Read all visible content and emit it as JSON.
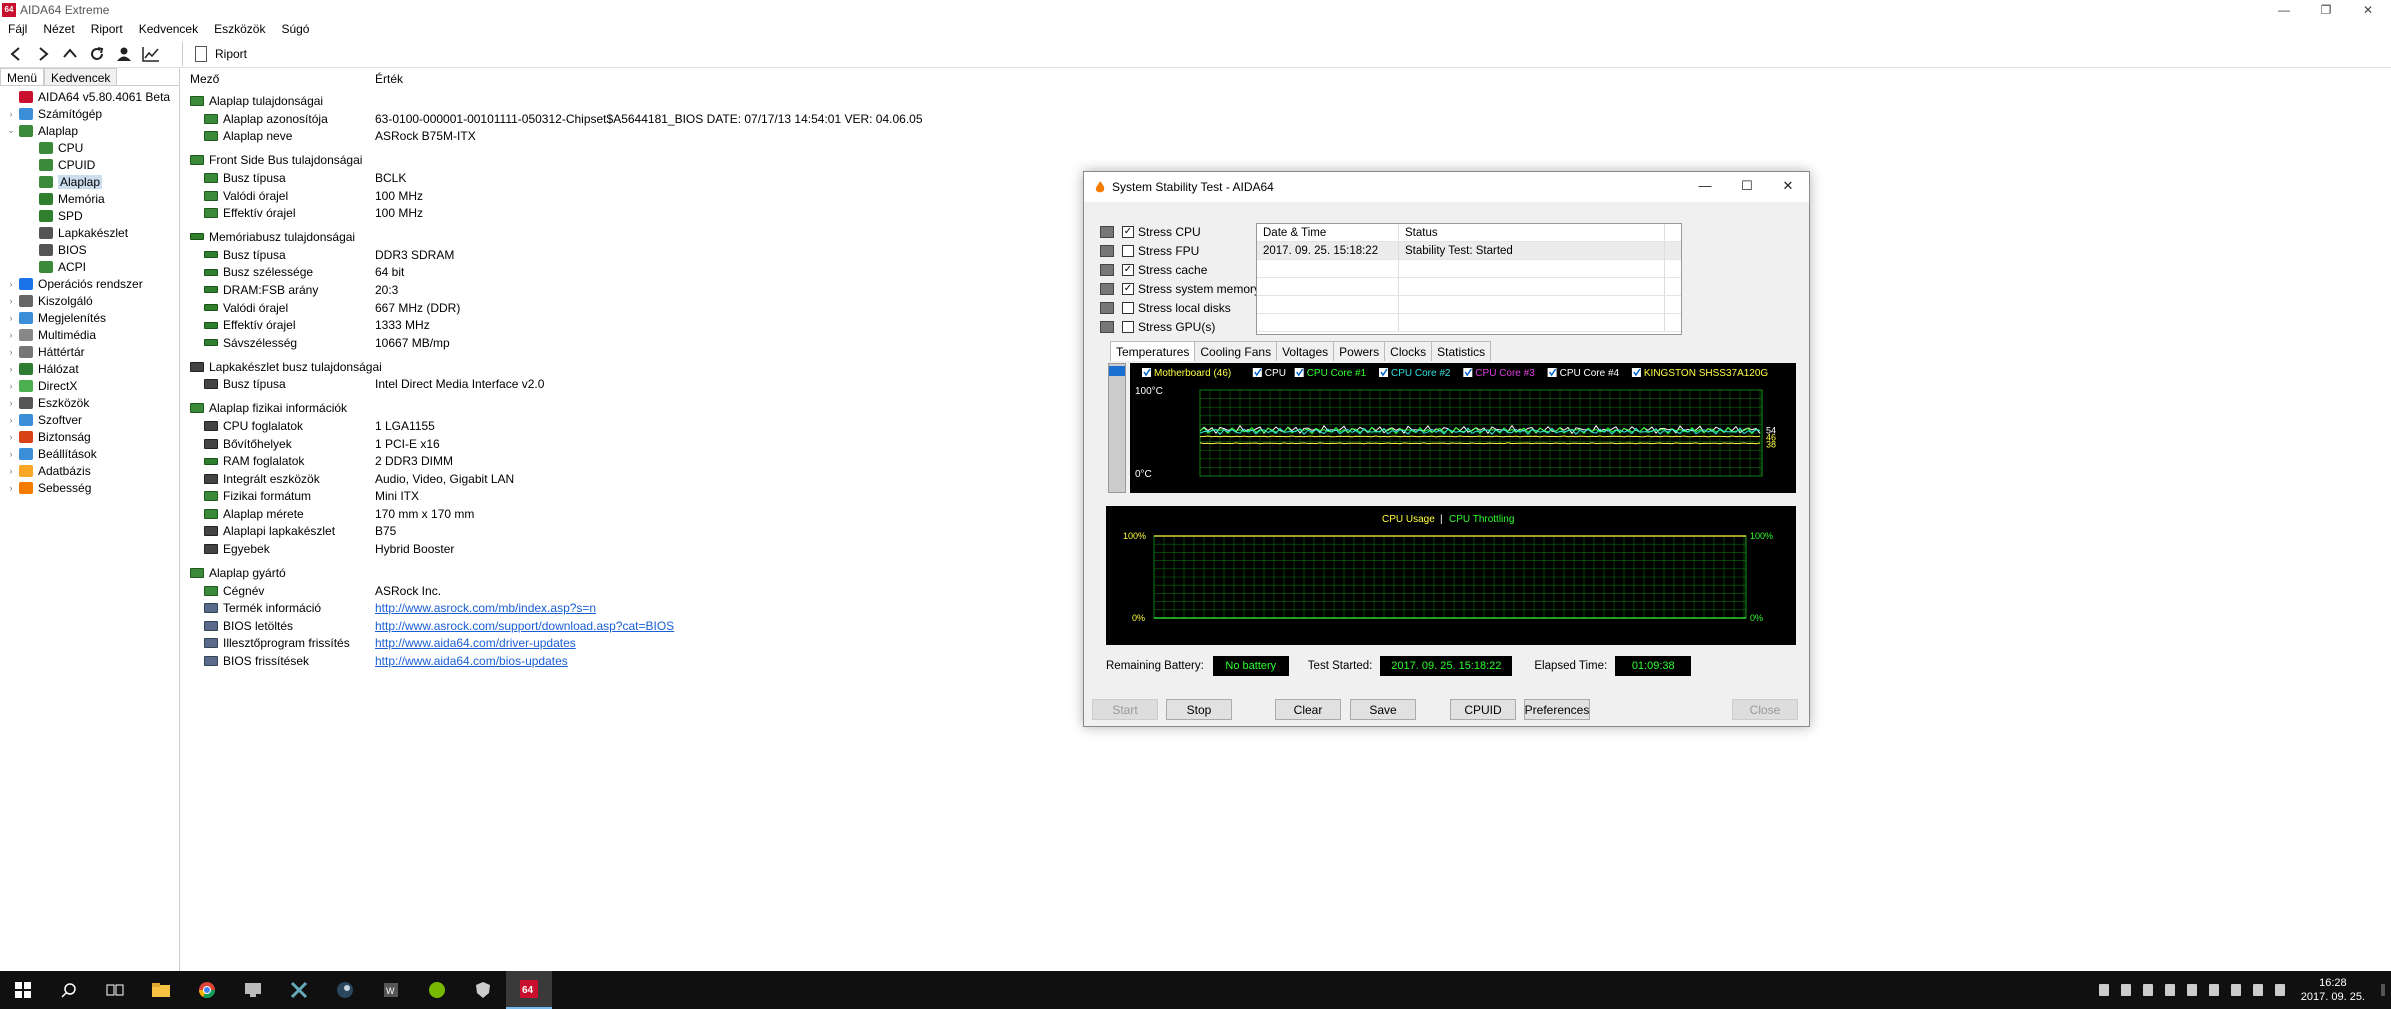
{
  "app": {
    "logo": "64",
    "title": "AIDA64 Extreme"
  },
  "menu": [
    "Fájl",
    "Nézet",
    "Riport",
    "Kedvencek",
    "Eszközök",
    "Súgó"
  ],
  "toolbar": {
    "report_label": "Riport"
  },
  "left_tabs": [
    "Menü",
    "Kedvencek"
  ],
  "tree": [
    {
      "label": "AIDA64 v5.80.4061 Beta",
      "level": 0,
      "expander": "",
      "icon": "aida-icon",
      "color": "#c8102e"
    },
    {
      "label": "Számítógép",
      "level": 0,
      "expander": "›",
      "icon": "computer-icon",
      "color": "#3b8fd8"
    },
    {
      "label": "Alaplap",
      "level": 0,
      "expander": "⌄",
      "icon": "motherboard-icon",
      "color": "#3a8a3a"
    },
    {
      "label": "CPU",
      "level": 1,
      "expander": "",
      "icon": "cpu-icon",
      "color": "#3a8a3a"
    },
    {
      "label": "CPUID",
      "level": 1,
      "expander": "",
      "icon": "cpuid-icon",
      "color": "#3a8a3a"
    },
    {
      "label": "Alaplap",
      "level": 1,
      "expander": "",
      "icon": "motherboard-icon",
      "color": "#3a8a3a",
      "selected": true
    },
    {
      "label": "Memória",
      "level": 1,
      "expander": "",
      "icon": "memory-icon",
      "color": "#2f7f2f"
    },
    {
      "label": "SPD",
      "level": 1,
      "expander": "",
      "icon": "spd-icon",
      "color": "#2f7f2f"
    },
    {
      "label": "Lapkakészlet",
      "level": 1,
      "expander": "",
      "icon": "chipset-icon",
      "color": "#555"
    },
    {
      "label": "BIOS",
      "level": 1,
      "expander": "",
      "icon": "bios-icon",
      "color": "#555"
    },
    {
      "label": "ACPI",
      "level": 1,
      "expander": "",
      "icon": "acpi-icon",
      "color": "#3a8a3a"
    },
    {
      "label": "Operációs rendszer",
      "level": 0,
      "expander": "›",
      "icon": "windows-icon",
      "color": "#1a73e8"
    },
    {
      "label": "Kiszolgáló",
      "level": 0,
      "expander": "›",
      "icon": "server-icon",
      "color": "#666"
    },
    {
      "label": "Megjelenítés",
      "level": 0,
      "expander": "›",
      "icon": "display-icon",
      "color": "#3b8fd8"
    },
    {
      "label": "Multimédia",
      "level": 0,
      "expander": "›",
      "icon": "multimedia-icon",
      "color": "#888"
    },
    {
      "label": "Háttértár",
      "level": 0,
      "expander": "›",
      "icon": "storage-icon",
      "color": "#777"
    },
    {
      "label": "Hálózat",
      "level": 0,
      "expander": "›",
      "icon": "network-icon",
      "color": "#2e7d32"
    },
    {
      "label": "DirectX",
      "level": 0,
      "expander": "›",
      "icon": "directx-icon",
      "color": "#4caf50"
    },
    {
      "label": "Eszközök",
      "level": 0,
      "expander": "›",
      "icon": "devices-icon",
      "color": "#555"
    },
    {
      "label": "Szoftver",
      "level": 0,
      "expander": "›",
      "icon": "software-icon",
      "color": "#3b8fd8"
    },
    {
      "label": "Biztonság",
      "level": 0,
      "expander": "›",
      "icon": "security-icon",
      "color": "#d84315"
    },
    {
      "label": "Beállítások",
      "level": 0,
      "expander": "›",
      "icon": "settings-icon",
      "color": "#3b8fd8"
    },
    {
      "label": "Adatbázis",
      "level": 0,
      "expander": "›",
      "icon": "database-icon",
      "color": "#f9a825"
    },
    {
      "label": "Sebesség",
      "level": 0,
      "expander": "›",
      "icon": "benchmark-icon",
      "color": "#f57c00"
    }
  ],
  "list_header": {
    "field": "Mező",
    "value": "Érték"
  },
  "groups": [
    {
      "title": "Alaplap tulajdonságai",
      "icon": "board",
      "rows": [
        {
          "field": "Alaplap azonosítója",
          "value": "63-0100-000001-00101111-050312-Chipset$A5644181_BIOS DATE: 07/17/13 14:54:01 VER: 04.06.05",
          "icon": "board"
        },
        {
          "field": "Alaplap neve",
          "value": "ASRock B75M-ITX",
          "icon": "board"
        }
      ]
    },
    {
      "title": "Front Side Bus tulajdonságai",
      "icon": "board",
      "rows": [
        {
          "field": "Busz típusa",
          "value": "BCLK",
          "icon": "board"
        },
        {
          "field": "Valódi órajel",
          "value": "100 MHz",
          "icon": "board"
        },
        {
          "field": "Effektív órajel",
          "value": "100 MHz",
          "icon": "board"
        }
      ]
    },
    {
      "title": "Memóriabusz tulajdonságai",
      "icon": "ram",
      "rows": [
        {
          "field": "Busz típusa",
          "value": "DDR3 SDRAM",
          "icon": "ram"
        },
        {
          "field": "Busz szélessége",
          "value": "64 bit",
          "icon": "ram"
        },
        {
          "field": "DRAM:FSB arány",
          "value": "20:3",
          "icon": "ram"
        },
        {
          "field": "Valódi órajel",
          "value": "667 MHz (DDR)",
          "icon": "ram"
        },
        {
          "field": "Effektív órajel",
          "value": "1333 MHz",
          "icon": "ram"
        },
        {
          "field": "Sávszélesség",
          "value": "10667 MB/mp",
          "icon": "ram"
        }
      ]
    },
    {
      "title": "Lapkakészlet busz tulajdonságai",
      "icon": "chip",
      "rows": [
        {
          "field": "Busz típusa",
          "value": "Intel Direct Media Interface v2.0",
          "icon": "chip"
        }
      ]
    },
    {
      "title": "Alaplap fizikai információk",
      "icon": "board",
      "rows": [
        {
          "field": "CPU foglalatok",
          "value": "1 LGA1155",
          "icon": "chip"
        },
        {
          "field": "Bővítőhelyek",
          "value": "1 PCI-E x16",
          "icon": "chip"
        },
        {
          "field": "RAM foglalatok",
          "value": "2 DDR3 DIMM",
          "icon": "ram"
        },
        {
          "field": "Integrált eszközök",
          "value": "Audio, Video, Gigabit LAN",
          "icon": "chip"
        },
        {
          "field": "Fizikai formátum",
          "value": "Mini ITX",
          "icon": "board"
        },
        {
          "field": "Alaplap mérete",
          "value": "170 mm x 170 mm",
          "icon": "board"
        },
        {
          "field": "Alaplapi lapkakészlet",
          "value": "B75",
          "icon": "chip"
        },
        {
          "field": "Egyebek",
          "value": "Hybrid Booster",
          "icon": "chip"
        }
      ]
    },
    {
      "title": "Alaplap gyártó",
      "icon": "board",
      "rows": [
        {
          "field": "Cégnév",
          "value": "ASRock Inc.",
          "icon": "board"
        },
        {
          "field": "Termék információ",
          "value": "http://www.asrock.com/mb/index.asp?s=n",
          "icon": "link",
          "link": true
        },
        {
          "field": "BIOS letöltés",
          "value": "http://www.asrock.com/support/download.asp?cat=BIOS",
          "icon": "link",
          "link": true
        },
        {
          "field": "Illesztőprogram frissítés",
          "value": "http://www.aida64.com/driver-updates",
          "icon": "link",
          "link": true
        },
        {
          "field": "BIOS frissítések",
          "value": "http://www.aida64.com/bios-updates",
          "icon": "link",
          "link": true
        }
      ]
    }
  ],
  "dialog": {
    "title": "System Stability Test - AIDA64",
    "stress": [
      {
        "label": "Stress CPU",
        "checked": true,
        "icon": "cpu-stress-icon"
      },
      {
        "label": "Stress FPU",
        "checked": false,
        "icon": "fpu-stress-icon"
      },
      {
        "label": "Stress cache",
        "checked": true,
        "icon": "cache-stress-icon"
      },
      {
        "label": "Stress system memory",
        "checked": true,
        "icon": "memory-stress-icon"
      },
      {
        "label": "Stress local disks",
        "checked": false,
        "icon": "disk-stress-icon"
      },
      {
        "label": "Stress GPU(s)",
        "checked": false,
        "icon": "gpu-stress-icon"
      }
    ],
    "log_headers": [
      "Date & Time",
      "Status"
    ],
    "log_rows": [
      [
        "2017. 09. 25. 15:18:22",
        "Stability Test: Started"
      ]
    ],
    "tabs": [
      "Temperatures",
      "Cooling Fans",
      "Voltages",
      "Powers",
      "Clocks",
      "Statistics"
    ],
    "active_tab": "Temperatures",
    "temp_legend": [
      {
        "label": "Motherboard (46)",
        "color": "#ffff40"
      },
      {
        "label": "CPU",
        "color": "#ffffff"
      },
      {
        "label": "CPU Core #1",
        "color": "#30ff30"
      },
      {
        "label": "CPU Core #2",
        "color": "#30e0e0"
      },
      {
        "label": "CPU Core #3",
        "color": "#e040e0"
      },
      {
        "label": "CPU Core #4",
        "color": "#ffffff"
      },
      {
        "label": "KINGSTON SHSS37A120G",
        "color": "#ffff40"
      }
    ],
    "temp_axis": {
      "top": "100°C",
      "bottom": "0°C"
    },
    "temp_readings": [
      "54",
      "46",
      "38"
    ],
    "usage_legend": {
      "usage": "CPU Usage",
      "sep": "|",
      "throttle": "CPU Throttling"
    },
    "usage_axis": {
      "top": "100%",
      "bottom": "0%"
    },
    "status": {
      "battery_label": "Remaining Battery:",
      "battery_value": "No battery",
      "started_label": "Test Started:",
      "started_value": "2017. 09. 25. 15:18:22",
      "elapsed_label": "Elapsed Time:",
      "elapsed_value": "01:09:38"
    },
    "buttons": {
      "start": "Start",
      "stop": "Stop",
      "clear": "Clear",
      "save": "Save",
      "cpuid": "CPUID",
      "preferences": "Preferences",
      "close": "Close"
    }
  },
  "clock": {
    "time": "16:28",
    "date": "2017. 09. 25."
  },
  "chart_data": {
    "type": "line",
    "title": "",
    "series": [
      {
        "name": "Motherboard (46)",
        "values": [
          46
        ]
      },
      {
        "name": "CPU Core #1",
        "values": [
          54
        ]
      },
      {
        "name": "KINGSTON SHSS37A120G",
        "values": [
          38
        ]
      }
    ],
    "ylim": [
      0,
      100
    ],
    "grid": true
  }
}
